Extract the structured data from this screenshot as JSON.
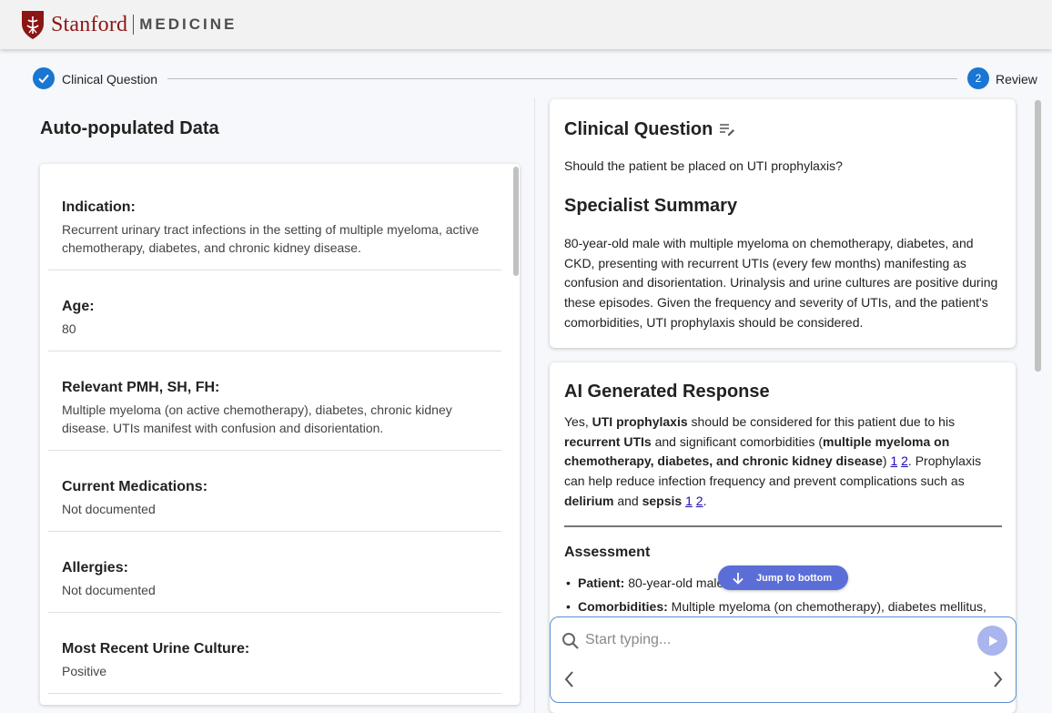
{
  "header": {
    "brand_primary": "Stanford",
    "brand_secondary": "MEDICINE",
    "brand_color": "#8c1515"
  },
  "stepper": {
    "steps": [
      {
        "label": "Clinical Question",
        "state": "completed"
      },
      {
        "label": "Review",
        "number": "2",
        "state": "active"
      }
    ],
    "accent": "#1976d2"
  },
  "left": {
    "title": "Auto-populated Data",
    "fields": [
      {
        "label": "Indication:",
        "value": "Recurrent urinary tract infections in the setting of multiple myeloma, active chemotherapy, diabetes, and chronic kidney disease."
      },
      {
        "label": "Age:",
        "value": "80"
      },
      {
        "label": "Relevant PMH, SH, FH:",
        "value": "Multiple myeloma (on active chemotherapy), diabetes, chronic kidney disease. UTIs manifest with confusion and disorientation."
      },
      {
        "label": "Current Medications:",
        "value": "Not documented"
      },
      {
        "label": "Allergies:",
        "value": "Not documented"
      },
      {
        "label": "Most Recent Urine Culture:",
        "value": "Positive"
      }
    ]
  },
  "question_card": {
    "title": "Clinical Question",
    "edit_icon": "edit-note-icon",
    "question": "Should the patient be placed on UTI prophylaxis?",
    "summary_title": "Specialist Summary",
    "summary": "80-year-old male with multiple myeloma on chemotherapy, diabetes, and CKD, presenting with recurrent UTIs (every few months) manifesting as confusion and disorientation. Urinalysis and urine cultures are positive during these episodes. Given the frequency and severity of UTIs, and the patient's comorbidities, UTI prophylaxis should be considered."
  },
  "ai_card": {
    "title": "AI Generated Response",
    "p1": "Yes, ",
    "p1_b1": "UTI prophylaxis",
    "p1_t2": " should be considered for this patient due to his ",
    "p1_b2": "recurrent UTIs",
    "p1_t3": " and significant comorbidities (",
    "p1_b3": "multiple myeloma on chemotherapy, diabetes, and chronic kidney disease",
    "p1_t4": ") ",
    "cite1": "1",
    "cite2": "2",
    "p1_t5": ". Prophylaxis can help reduce infection frequency and prevent complications such as ",
    "p1_b4": "delirium",
    "p1_t6": " and ",
    "p1_b5": "sepsis",
    "p1_t7": ".",
    "assessment_title": "Assessment",
    "bullets": [
      {
        "label": "Patient:",
        "text": " 80-year-old male"
      },
      {
        "label": "Comorbidities:",
        "text": " Multiple myeloma (on chemotherapy), diabetes mellitus,"
      }
    ]
  },
  "jump_button": {
    "label": "Jump to bottom"
  },
  "composer": {
    "placeholder": "Start typing...",
    "send_color": "#a9b5ec"
  }
}
